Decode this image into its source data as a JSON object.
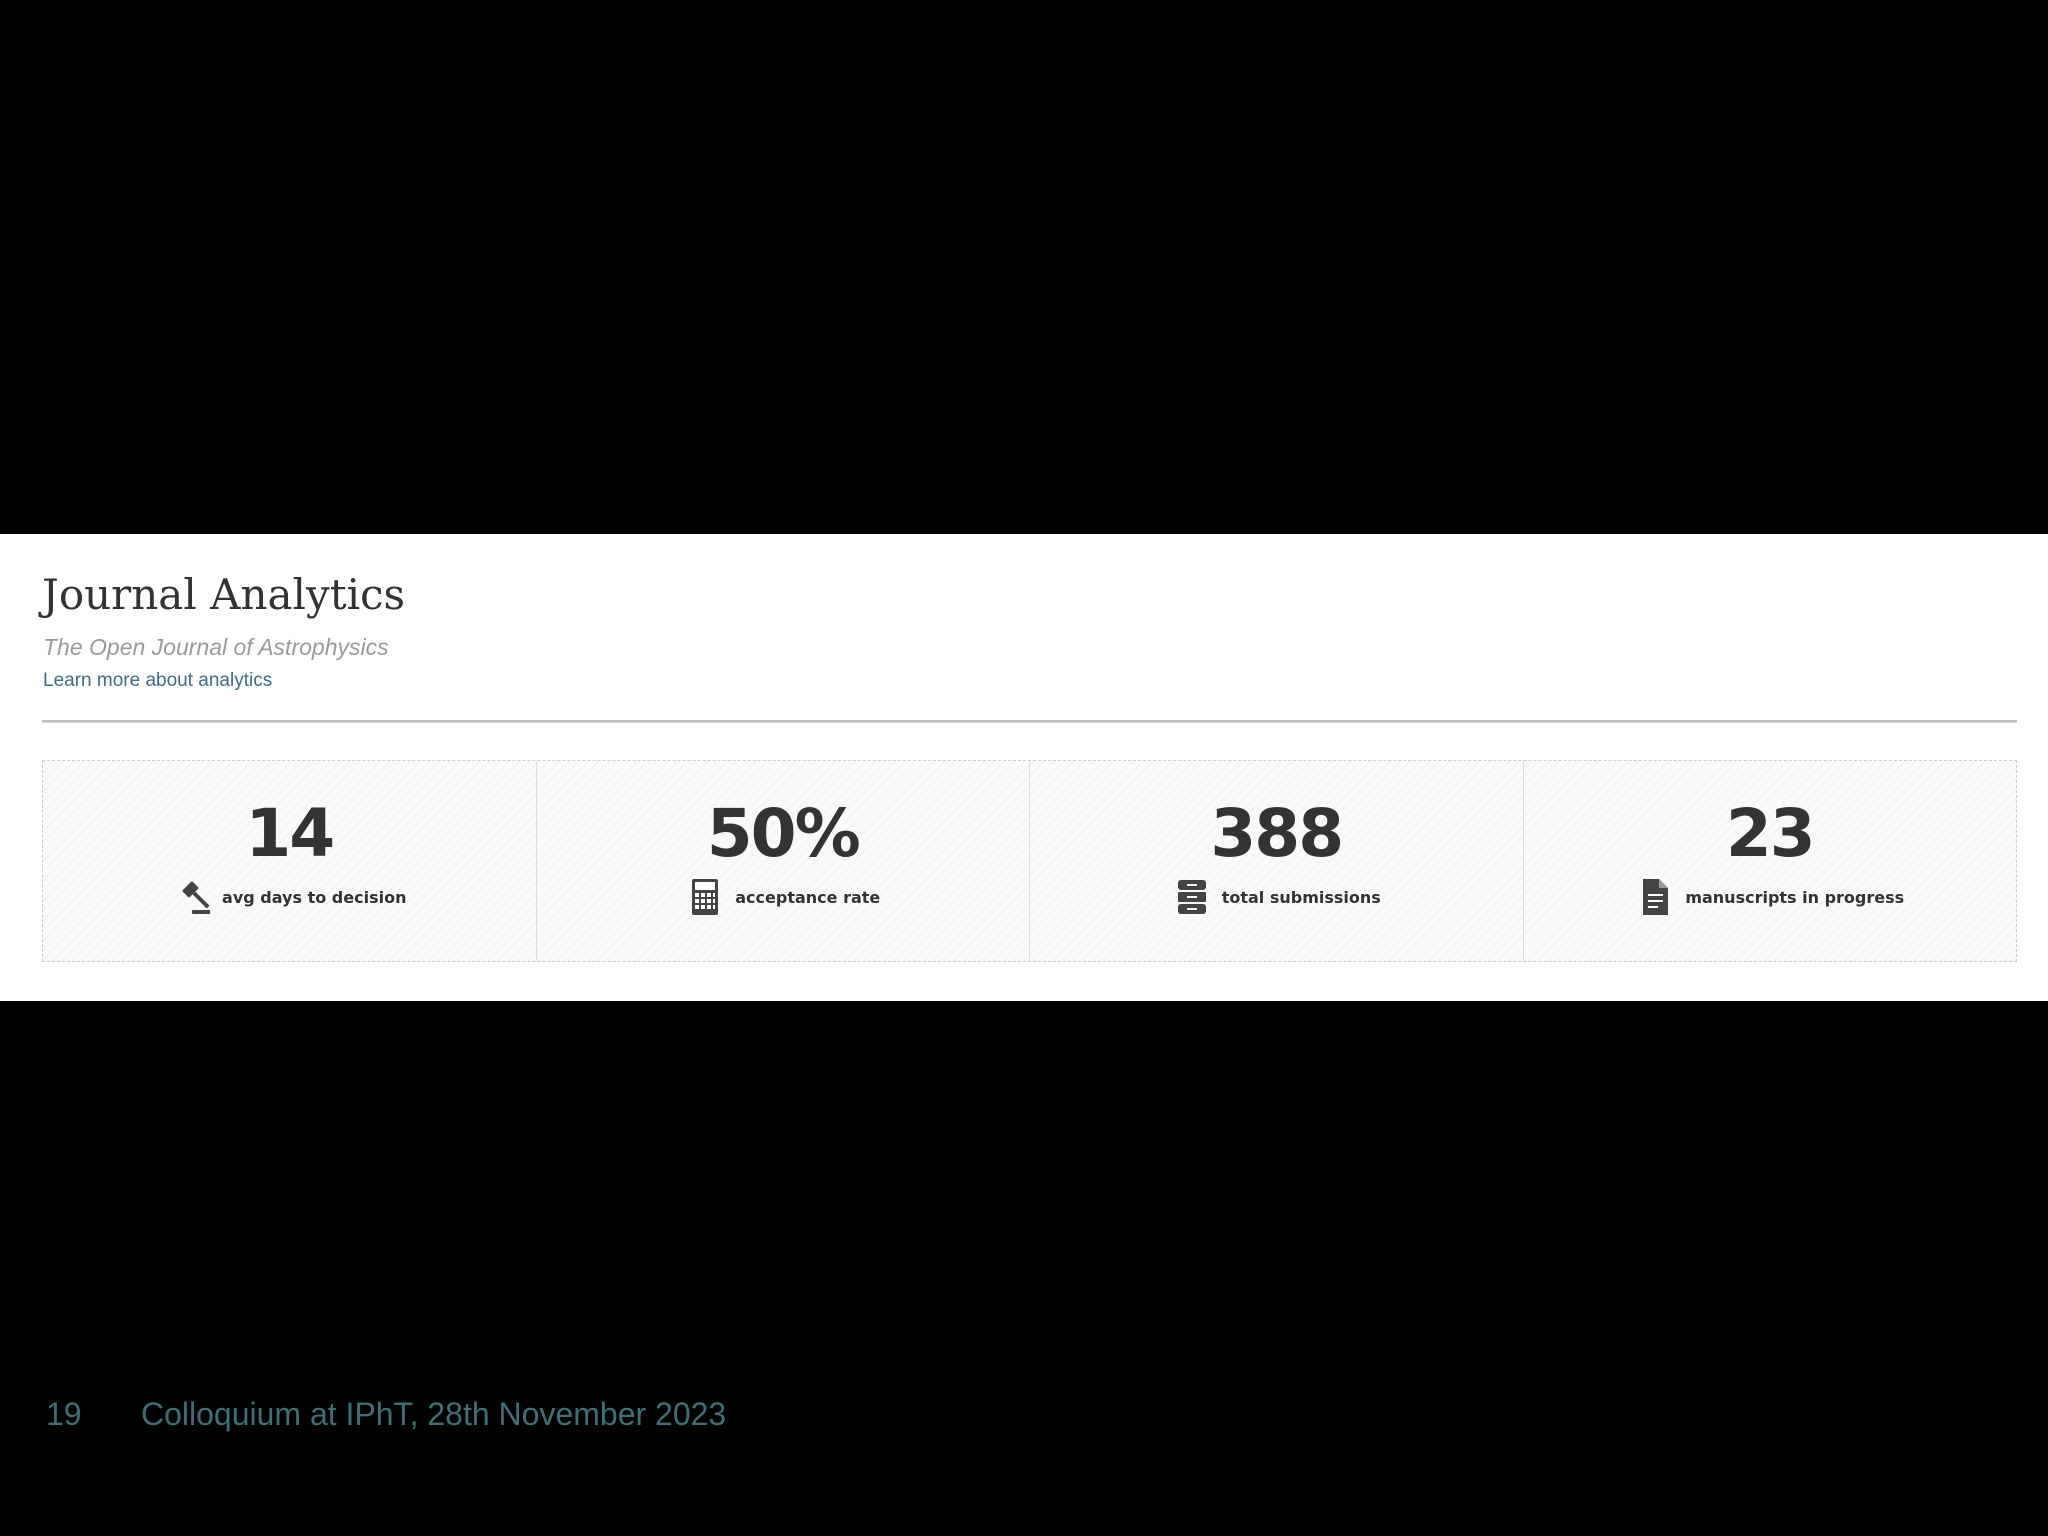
{
  "header": {
    "title": "Journal Analytics",
    "subtitle": "The Open Journal of Astrophysics",
    "learn_more_link": "Learn more about analytics"
  },
  "stats": [
    {
      "value": "14",
      "label": "avg days to decision",
      "icon": "gavel-icon"
    },
    {
      "value": "50%",
      "label": "acceptance rate",
      "icon": "calculator-icon"
    },
    {
      "value": "388",
      "label": "total submissions",
      "icon": "archive-drawers-icon"
    },
    {
      "value": "23",
      "label": "manuscripts in progress",
      "icon": "document-icon"
    }
  ],
  "footer": {
    "page_number": "19",
    "text": "Colloquium at IPhT, 28th November 2023"
  },
  "colors": {
    "background": "#000000",
    "panel": "#ffffff",
    "link": "#3f6e86",
    "footer_text": "#3f6e74",
    "stat_text": "#333333"
  }
}
